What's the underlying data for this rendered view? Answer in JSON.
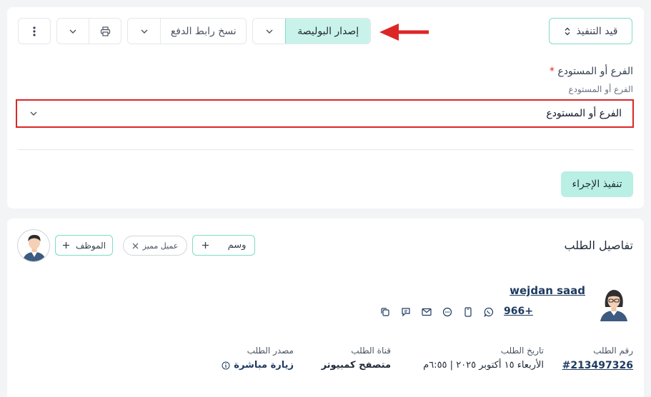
{
  "toolbar": {
    "execution_status_label": "قيد التنفيذ",
    "issue_policy_label": "إصدار البوليصة",
    "copy_payment_link_label": "نسخ رابط الدفع"
  },
  "form": {
    "field_label": "الفرع أو المستودع",
    "required_mark": "*",
    "field_hint": "الفرع أو المستودع",
    "select_value": "الفرع أو المستودع",
    "execute_button_label": "تنفيذ الإجراء"
  },
  "details": {
    "title": "تفاصيل الطلب",
    "tag_button_label": "وسم",
    "tag_chip_label": "عميل مميز",
    "employee_button_label": "الموظف",
    "customer_name": "wejdan saad",
    "customer_phone": "966+",
    "fields": [
      {
        "label": "رقم الطلب",
        "value": "#213497326"
      },
      {
        "label": "تاريخ الطلب",
        "value": "الأربعاء ١٥ أكتوبر ٢٠٢٥ | ٦:٥٥م"
      },
      {
        "label": "قناة الطلب",
        "value": "متصفح كمبيوتر"
      },
      {
        "label": "مصدر الطلب",
        "value": "زيارة مباشرة"
      }
    ]
  },
  "colors": {
    "accent_teal": "#b9efe4",
    "accent_border": "#7fdcc6",
    "highlight_red": "#dc2626",
    "link_blue": "#1e3a5f"
  }
}
